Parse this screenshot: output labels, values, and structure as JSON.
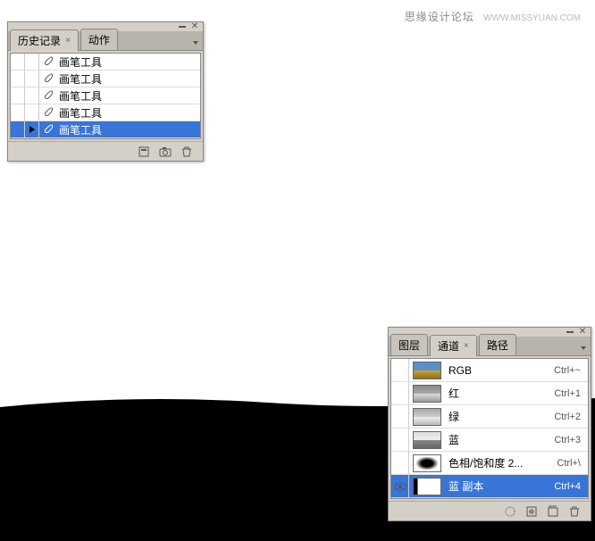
{
  "watermark": {
    "text": "思缘设计论坛",
    "url": "WWW.MISSYUAN.COM"
  },
  "history_panel": {
    "tabs": [
      {
        "label": "历史记录",
        "active": true,
        "closeable": true
      },
      {
        "label": "动作",
        "active": false,
        "closeable": false
      }
    ],
    "items": [
      {
        "label": "画笔工具",
        "selected": false,
        "marker": false
      },
      {
        "label": "画笔工具",
        "selected": false,
        "marker": false
      },
      {
        "label": "画笔工具",
        "selected": false,
        "marker": false
      },
      {
        "label": "画笔工具",
        "selected": false,
        "marker": false
      },
      {
        "label": "画笔工具",
        "selected": true,
        "marker": true
      }
    ]
  },
  "channels_panel": {
    "tabs": [
      {
        "label": "图层",
        "active": false
      },
      {
        "label": "通道",
        "active": true,
        "closeable": true
      },
      {
        "label": "路径",
        "active": false
      }
    ],
    "channels": [
      {
        "label": "RGB",
        "shortcut": "Ctrl+~",
        "visible": false,
        "thumb": "thumb-rgb"
      },
      {
        "label": "红",
        "shortcut": "Ctrl+1",
        "visible": false,
        "thumb": "thumb-red"
      },
      {
        "label": "绿",
        "shortcut": "Ctrl+2",
        "visible": false,
        "thumb": "thumb-green"
      },
      {
        "label": "蓝",
        "shortcut": "Ctrl+3",
        "visible": false,
        "thumb": "thumb-blue"
      },
      {
        "label": "色相/饱和度 2...",
        "shortcut": "Ctrl+\\",
        "visible": false,
        "thumb": "thumb-hsl"
      },
      {
        "label": "蓝 副本",
        "shortcut": "Ctrl+4",
        "visible": true,
        "thumb": "thumb-bluecopy",
        "selected": true
      }
    ]
  }
}
